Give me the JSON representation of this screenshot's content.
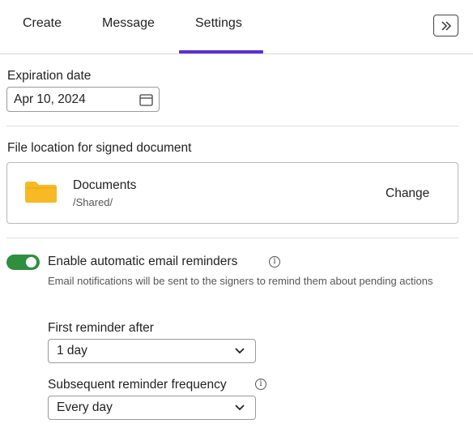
{
  "tabs": {
    "items": [
      {
        "label": "Create"
      },
      {
        "label": "Message"
      },
      {
        "label": "Settings",
        "active": true
      }
    ],
    "collapse_icon": "double-chevron-right-icon",
    "accent_color": "#5b2fd6"
  },
  "expiration": {
    "label": "Expiration date",
    "value": "Apr 10, 2024",
    "icon": "calendar-icon"
  },
  "file_location": {
    "label": "File location for signed document",
    "folder_name": "Documents",
    "folder_path": "/Shared/",
    "change_label": "Change",
    "folder_icon": "folder-icon",
    "folder_color": "#f7b924"
  },
  "reminders": {
    "enabled": true,
    "toggle_color": "#2f8f3f",
    "label": "Enable automatic email reminders",
    "helper": "Email notifications will be sent to the signers to remind them about pending actions",
    "first_label": "First reminder after",
    "first_value": "1 day",
    "subsequent_label": "Subsequent reminder frequency",
    "subsequent_value": "Every day"
  }
}
